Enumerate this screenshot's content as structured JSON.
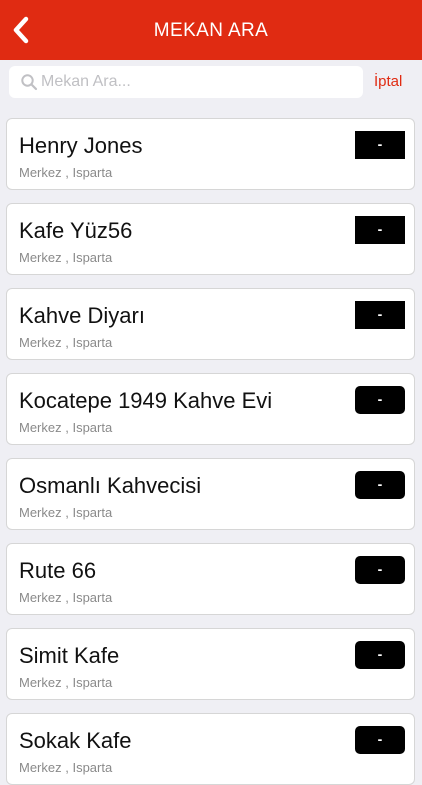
{
  "header": {
    "title": "MEKAN ARA",
    "back_icon": "chevron-left-icon",
    "background": "#e02b12"
  },
  "search": {
    "placeholder": "Mekan Ara...",
    "value": "",
    "cancel_label": "İptal",
    "icon": "search-icon"
  },
  "venues": [
    {
      "name": "Henry Jones",
      "location": "Merkez , Isparta",
      "badge": "-",
      "badge_style": "square"
    },
    {
      "name": "Kafe Yüz56",
      "location": "Merkez , Isparta",
      "badge": "-",
      "badge_style": "square"
    },
    {
      "name": "Kahve Diyarı",
      "location": "Merkez , Isparta",
      "badge": "-",
      "badge_style": "square"
    },
    {
      "name": "Kocatepe 1949 Kahve Evi",
      "location": "Merkez , Isparta",
      "badge": "-",
      "badge_style": "rounded"
    },
    {
      "name": "Osmanlı Kahvecisi",
      "location": "Merkez , Isparta",
      "badge": "-",
      "badge_style": "rounded"
    },
    {
      "name": "Rute 66",
      "location": "Merkez , Isparta",
      "badge": "-",
      "badge_style": "rounded"
    },
    {
      "name": "Simit Kafe",
      "location": "Merkez , Isparta",
      "badge": "-",
      "badge_style": "rounded"
    },
    {
      "name": "Sokak Kafe",
      "location": "Merkez , Isparta",
      "badge": "-",
      "badge_style": "rounded"
    }
  ]
}
